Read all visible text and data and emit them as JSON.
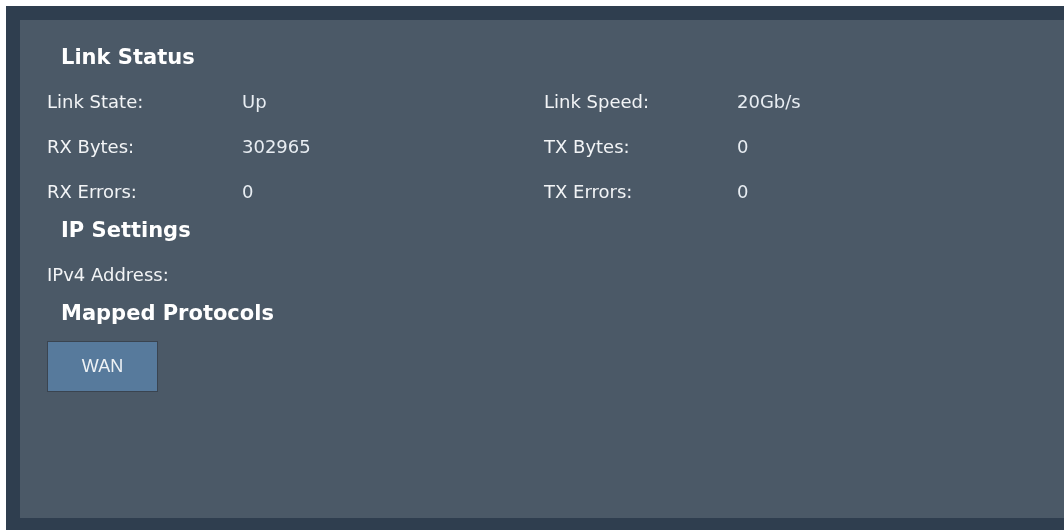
{
  "sections": [
    {
      "kind": "stats",
      "title": "Link Status",
      "rows": [
        {
          "left": {
            "label": "Link State:",
            "value": "Up"
          },
          "right": {
            "label": "Link Speed:",
            "value": "20Gb/s"
          }
        },
        {
          "left": {
            "label": "RX Bytes:",
            "value": "302965"
          },
          "right": {
            "label": "TX Bytes:",
            "value": "0"
          }
        },
        {
          "left": {
            "label": "RX Errors:",
            "value": "0"
          },
          "right": {
            "label": "TX Errors:",
            "value": "0"
          }
        }
      ]
    },
    {
      "kind": "fields",
      "title": "IP Settings",
      "fields": [
        {
          "label": "IPv4 Address:"
        }
      ]
    },
    {
      "kind": "buttons",
      "title": "Mapped Protocols",
      "buttons": [
        "WAN"
      ]
    }
  ]
}
